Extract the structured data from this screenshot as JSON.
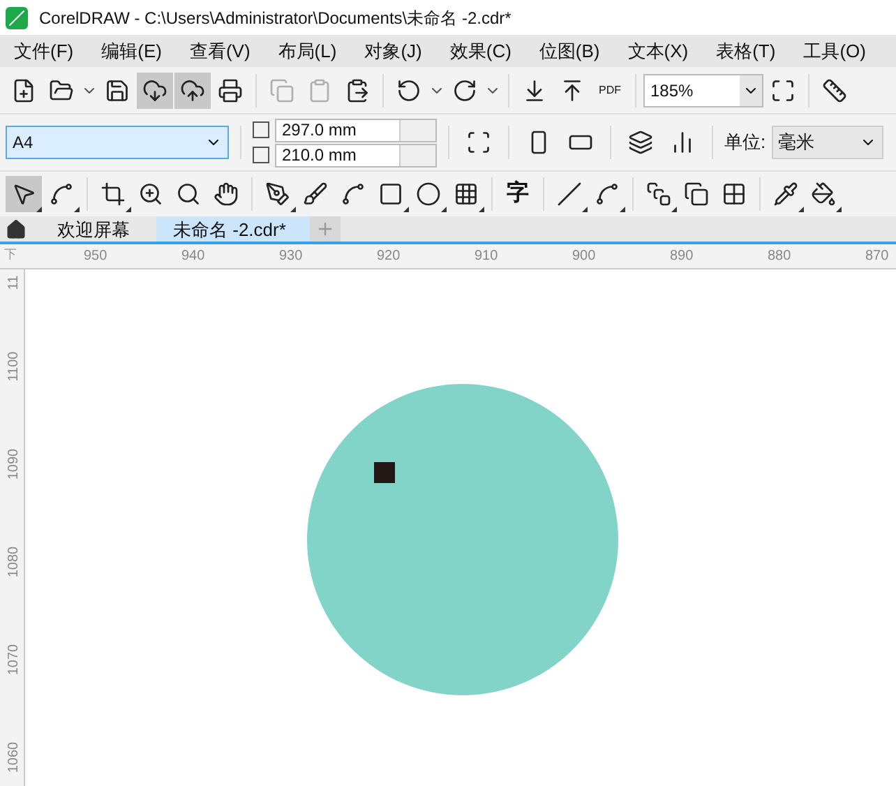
{
  "window": {
    "title": "CorelDRAW - C:\\Users\\Administrator\\Documents\\未命名 -2.cdr*"
  },
  "menu": [
    "文件(F)",
    "编辑(E)",
    "查看(V)",
    "布局(L)",
    "对象(J)",
    "效果(C)",
    "位图(B)",
    "文本(X)",
    "表格(T)",
    "工具(O)"
  ],
  "toolbar": {
    "pdf_label": "PDF",
    "zoom": "185%"
  },
  "property_bar": {
    "page_size": "A4",
    "height": "297.0 mm",
    "width": "210.0 mm",
    "units_label": "单位:",
    "units": "毫米"
  },
  "toolbox": {
    "text_tool": "字"
  },
  "tabs": [
    {
      "label": "欢迎屏幕",
      "selected": false
    },
    {
      "label": "未命名 -2.cdr*",
      "selected": true
    }
  ],
  "ruler": {
    "horizontal": [
      "950",
      "940",
      "930",
      "920",
      "910",
      "900",
      "890",
      "880",
      "870"
    ],
    "corner": "下",
    "vertical": [
      "11",
      "1100",
      "1090",
      "1080",
      "1070",
      "1060"
    ]
  },
  "canvas": {
    "shapes": [
      {
        "kind": "circle",
        "color": "#83d4c8"
      },
      {
        "kind": "square",
        "color": "#231815"
      }
    ]
  }
}
